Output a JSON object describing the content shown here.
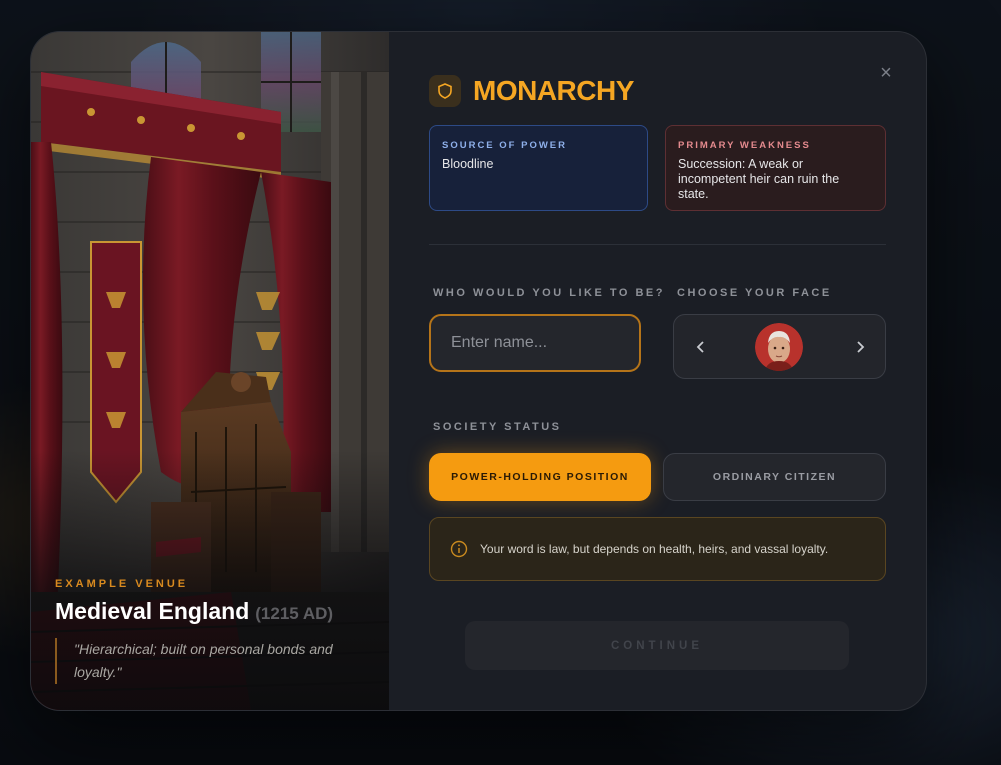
{
  "modal": {
    "title": "MONARCHY",
    "close_symbol": "×",
    "venue": {
      "label": "EXAMPLE VENUE",
      "name": "Medieval England",
      "year": "(1215 AD)",
      "quote": "\"Hierarchical; built on personal bonds and loyalty.\""
    },
    "source_of_power": {
      "label": "SOURCE OF POWER",
      "value": "Bloodline"
    },
    "primary_weakness": {
      "label": "PRIMARY WEAKNESS",
      "value": "Succession: A weak or incompetent heir can ruin the state."
    },
    "identity": {
      "label": "WHO WOULD YOU LIKE TO BE?",
      "name_value": "",
      "name_placeholder": "Enter name..."
    },
    "face": {
      "label": "CHOOSE YOUR FACE"
    },
    "status": {
      "label": "SOCIETY STATUS",
      "options": [
        "POWER-HOLDING POSITION",
        "ORDINARY CITIZEN"
      ],
      "selected": "POWER-HOLDING POSITION"
    },
    "hint": "Your word is law, but depends on health, heirs, and vassal loyalty.",
    "continue_label": "CONTINUE"
  },
  "icons": {
    "header": "shield-icon",
    "close": "close-icon",
    "prev": "chevron-left-icon",
    "next": "chevron-right-icon",
    "hint": "info-icon"
  },
  "colors": {
    "accent": "#f5a623",
    "power_card_border": "#2d4a86",
    "weakness_card_border": "#5e2f33",
    "selected_button": "#f59b10"
  }
}
